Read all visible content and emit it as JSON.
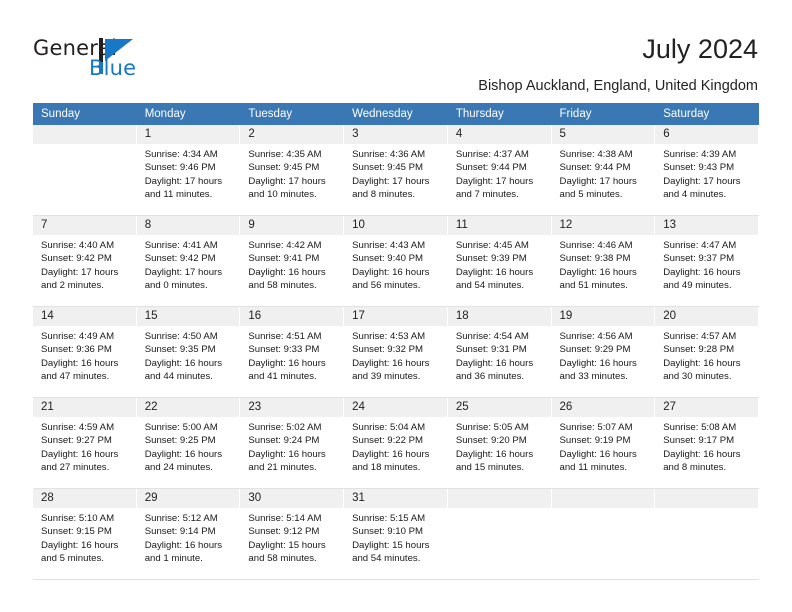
{
  "brand": {
    "name_part1": "General",
    "name_part2": "Blue",
    "accent_color": "#1878c8"
  },
  "header": {
    "title": "July 2024",
    "location": "Bishop Auckland, England, United Kingdom",
    "header_bg_color": "#3a78b5"
  },
  "weekdays": [
    "Sunday",
    "Monday",
    "Tuesday",
    "Wednesday",
    "Thursday",
    "Friday",
    "Saturday"
  ],
  "weeks": [
    [
      {
        "day": "",
        "sunrise": "",
        "sunset": "",
        "daylight_line1": "",
        "daylight_line2": ""
      },
      {
        "day": "1",
        "sunrise": "Sunrise: 4:34 AM",
        "sunset": "Sunset: 9:46 PM",
        "daylight_line1": "Daylight: 17 hours",
        "daylight_line2": "and 11 minutes."
      },
      {
        "day": "2",
        "sunrise": "Sunrise: 4:35 AM",
        "sunset": "Sunset: 9:45 PM",
        "daylight_line1": "Daylight: 17 hours",
        "daylight_line2": "and 10 minutes."
      },
      {
        "day": "3",
        "sunrise": "Sunrise: 4:36 AM",
        "sunset": "Sunset: 9:45 PM",
        "daylight_line1": "Daylight: 17 hours",
        "daylight_line2": "and 8 minutes."
      },
      {
        "day": "4",
        "sunrise": "Sunrise: 4:37 AM",
        "sunset": "Sunset: 9:44 PM",
        "daylight_line1": "Daylight: 17 hours",
        "daylight_line2": "and 7 minutes."
      },
      {
        "day": "5",
        "sunrise": "Sunrise: 4:38 AM",
        "sunset": "Sunset: 9:44 PM",
        "daylight_line1": "Daylight: 17 hours",
        "daylight_line2": "and 5 minutes."
      },
      {
        "day": "6",
        "sunrise": "Sunrise: 4:39 AM",
        "sunset": "Sunset: 9:43 PM",
        "daylight_line1": "Daylight: 17 hours",
        "daylight_line2": "and 4 minutes."
      }
    ],
    [
      {
        "day": "7",
        "sunrise": "Sunrise: 4:40 AM",
        "sunset": "Sunset: 9:42 PM",
        "daylight_line1": "Daylight: 17 hours",
        "daylight_line2": "and 2 minutes."
      },
      {
        "day": "8",
        "sunrise": "Sunrise: 4:41 AM",
        "sunset": "Sunset: 9:42 PM",
        "daylight_line1": "Daylight: 17 hours",
        "daylight_line2": "and 0 minutes."
      },
      {
        "day": "9",
        "sunrise": "Sunrise: 4:42 AM",
        "sunset": "Sunset: 9:41 PM",
        "daylight_line1": "Daylight: 16 hours",
        "daylight_line2": "and 58 minutes."
      },
      {
        "day": "10",
        "sunrise": "Sunrise: 4:43 AM",
        "sunset": "Sunset: 9:40 PM",
        "daylight_line1": "Daylight: 16 hours",
        "daylight_line2": "and 56 minutes."
      },
      {
        "day": "11",
        "sunrise": "Sunrise: 4:45 AM",
        "sunset": "Sunset: 9:39 PM",
        "daylight_line1": "Daylight: 16 hours",
        "daylight_line2": "and 54 minutes."
      },
      {
        "day": "12",
        "sunrise": "Sunrise: 4:46 AM",
        "sunset": "Sunset: 9:38 PM",
        "daylight_line1": "Daylight: 16 hours",
        "daylight_line2": "and 51 minutes."
      },
      {
        "day": "13",
        "sunrise": "Sunrise: 4:47 AM",
        "sunset": "Sunset: 9:37 PM",
        "daylight_line1": "Daylight: 16 hours",
        "daylight_line2": "and 49 minutes."
      }
    ],
    [
      {
        "day": "14",
        "sunrise": "Sunrise: 4:49 AM",
        "sunset": "Sunset: 9:36 PM",
        "daylight_line1": "Daylight: 16 hours",
        "daylight_line2": "and 47 minutes."
      },
      {
        "day": "15",
        "sunrise": "Sunrise: 4:50 AM",
        "sunset": "Sunset: 9:35 PM",
        "daylight_line1": "Daylight: 16 hours",
        "daylight_line2": "and 44 minutes."
      },
      {
        "day": "16",
        "sunrise": "Sunrise: 4:51 AM",
        "sunset": "Sunset: 9:33 PM",
        "daylight_line1": "Daylight: 16 hours",
        "daylight_line2": "and 41 minutes."
      },
      {
        "day": "17",
        "sunrise": "Sunrise: 4:53 AM",
        "sunset": "Sunset: 9:32 PM",
        "daylight_line1": "Daylight: 16 hours",
        "daylight_line2": "and 39 minutes."
      },
      {
        "day": "18",
        "sunrise": "Sunrise: 4:54 AM",
        "sunset": "Sunset: 9:31 PM",
        "daylight_line1": "Daylight: 16 hours",
        "daylight_line2": "and 36 minutes."
      },
      {
        "day": "19",
        "sunrise": "Sunrise: 4:56 AM",
        "sunset": "Sunset: 9:29 PM",
        "daylight_line1": "Daylight: 16 hours",
        "daylight_line2": "and 33 minutes."
      },
      {
        "day": "20",
        "sunrise": "Sunrise: 4:57 AM",
        "sunset": "Sunset: 9:28 PM",
        "daylight_line1": "Daylight: 16 hours",
        "daylight_line2": "and 30 minutes."
      }
    ],
    [
      {
        "day": "21",
        "sunrise": "Sunrise: 4:59 AM",
        "sunset": "Sunset: 9:27 PM",
        "daylight_line1": "Daylight: 16 hours",
        "daylight_line2": "and 27 minutes."
      },
      {
        "day": "22",
        "sunrise": "Sunrise: 5:00 AM",
        "sunset": "Sunset: 9:25 PM",
        "daylight_line1": "Daylight: 16 hours",
        "daylight_line2": "and 24 minutes."
      },
      {
        "day": "23",
        "sunrise": "Sunrise: 5:02 AM",
        "sunset": "Sunset: 9:24 PM",
        "daylight_line1": "Daylight: 16 hours",
        "daylight_line2": "and 21 minutes."
      },
      {
        "day": "24",
        "sunrise": "Sunrise: 5:04 AM",
        "sunset": "Sunset: 9:22 PM",
        "daylight_line1": "Daylight: 16 hours",
        "daylight_line2": "and 18 minutes."
      },
      {
        "day": "25",
        "sunrise": "Sunrise: 5:05 AM",
        "sunset": "Sunset: 9:20 PM",
        "daylight_line1": "Daylight: 16 hours",
        "daylight_line2": "and 15 minutes."
      },
      {
        "day": "26",
        "sunrise": "Sunrise: 5:07 AM",
        "sunset": "Sunset: 9:19 PM",
        "daylight_line1": "Daylight: 16 hours",
        "daylight_line2": "and 11 minutes."
      },
      {
        "day": "27",
        "sunrise": "Sunrise: 5:08 AM",
        "sunset": "Sunset: 9:17 PM",
        "daylight_line1": "Daylight: 16 hours",
        "daylight_line2": "and 8 minutes."
      }
    ],
    [
      {
        "day": "28",
        "sunrise": "Sunrise: 5:10 AM",
        "sunset": "Sunset: 9:15 PM",
        "daylight_line1": "Daylight: 16 hours",
        "daylight_line2": "and 5 minutes."
      },
      {
        "day": "29",
        "sunrise": "Sunrise: 5:12 AM",
        "sunset": "Sunset: 9:14 PM",
        "daylight_line1": "Daylight: 16 hours",
        "daylight_line2": "and 1 minute."
      },
      {
        "day": "30",
        "sunrise": "Sunrise: 5:14 AM",
        "sunset": "Sunset: 9:12 PM",
        "daylight_line1": "Daylight: 15 hours",
        "daylight_line2": "and 58 minutes."
      },
      {
        "day": "31",
        "sunrise": "Sunrise: 5:15 AM",
        "sunset": "Sunset: 9:10 PM",
        "daylight_line1": "Daylight: 15 hours",
        "daylight_line2": "and 54 minutes."
      },
      {
        "day": "",
        "sunrise": "",
        "sunset": "",
        "daylight_line1": "",
        "daylight_line2": ""
      },
      {
        "day": "",
        "sunrise": "",
        "sunset": "",
        "daylight_line1": "",
        "daylight_line2": ""
      },
      {
        "day": "",
        "sunrise": "",
        "sunset": "",
        "daylight_line1": "",
        "daylight_line2": ""
      }
    ]
  ]
}
